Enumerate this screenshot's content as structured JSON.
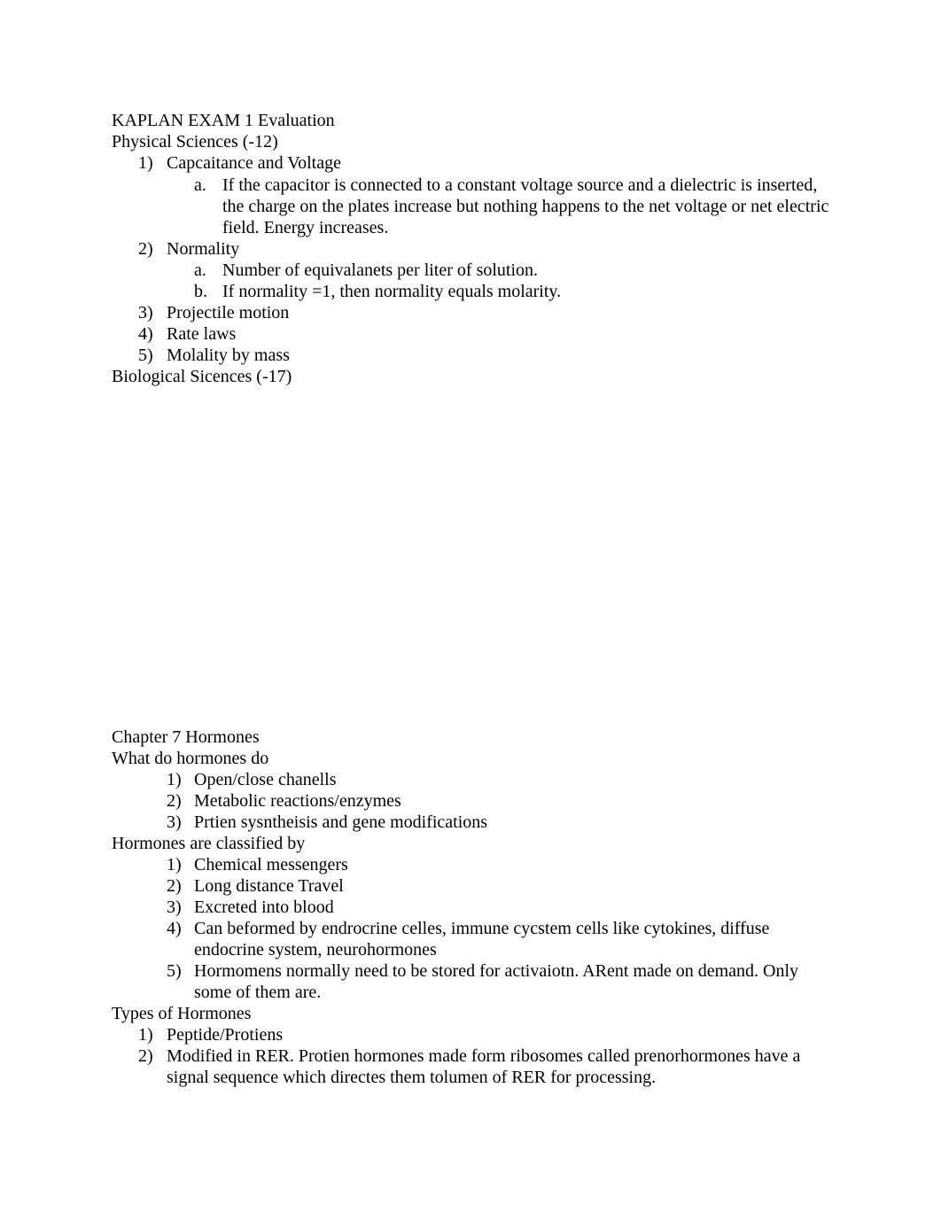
{
  "title": "KAPLAN EXAM 1 Evaluation",
  "physical_sciences": {
    "heading": "Physical Sciences (-12)",
    "items": [
      {
        "num": "1)",
        "text": "Capcaitance and Voltage",
        "sub": [
          {
            "num": "a.",
            "text": "If the capacitor is connected to a constant voltage source and a dielectric is inserted, the charge on the plates increase but nothing happens to the net voltage or net electric field. Energy increases."
          }
        ]
      },
      {
        "num": "2)",
        "text": "Normality",
        "sub": [
          {
            "num": "a.",
            "text": "Number of equivalanets per liter of solution."
          },
          {
            "num": "b.",
            "text": "If normality =1, then normality equals molarity."
          }
        ]
      },
      {
        "num": "3)",
        "text": "Projectile motion"
      },
      {
        "num": "4)",
        "text": "Rate laws"
      },
      {
        "num": "5)",
        "text": "Molality by mass"
      }
    ]
  },
  "biological_sciences": {
    "heading": "Biological Sicences (-17)"
  },
  "chapter7": {
    "heading": "Chapter 7 Hormones",
    "what_do": {
      "heading": "What do hormones do",
      "items": [
        {
          "num": "1)",
          "text": "Open/close chanells"
        },
        {
          "num": "2)",
          "text": "Metabolic reactions/enzymes"
        },
        {
          "num": "3)",
          "text": "Prtien sysntheisis and gene modifications"
        }
      ]
    },
    "classified_by": {
      "heading": "Hormones are classified by",
      "items": [
        {
          "num": "1)",
          "text": "Chemical messengers"
        },
        {
          "num": "2)",
          "text": "Long distance Travel"
        },
        {
          "num": "3)",
          "text": "Excreted into blood"
        },
        {
          "num": "4)",
          "text": "Can beformed by endrocrine celles, immune cycstem cells like cytokines, diffuse endocrine system, neurohormones"
        },
        {
          "num": "5)",
          "text": "Hormomens normally need to be stored for activaiotn. ARent made on demand. Only some of them are."
        }
      ]
    },
    "types": {
      "heading": "Types of Hormones",
      "items": [
        {
          "num": "1)",
          "text": "Peptide/Protiens"
        },
        {
          "num": "2)",
          "text": "Modified in RER. Protien hormones made form ribosomes called prenorhormones have a signal sequence which directes them tolumen of RER for processing."
        }
      ]
    }
  }
}
